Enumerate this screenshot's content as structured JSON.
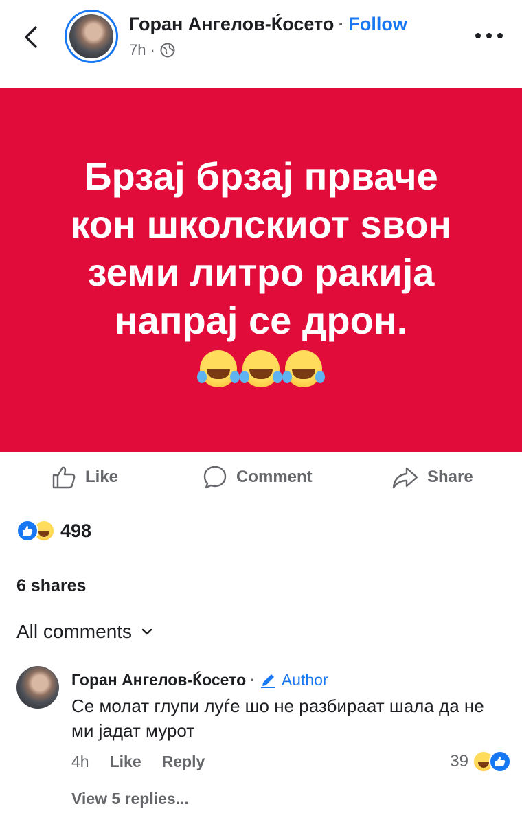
{
  "post": {
    "author": "Горан Ангелов-Ќосето",
    "separator": "·",
    "follow_label": "Follow",
    "time": "7h",
    "time_sep": "·",
    "privacy_icon": "globe-icon"
  },
  "banner": {
    "background": "#e10c3a",
    "lines": [
      "Брзај брзај прваче",
      "кон школскиот ѕвон",
      "земи литро ракија",
      "напрај се дрон."
    ],
    "emoji_icon": "laughing-tears-emoji"
  },
  "actions": {
    "like": "Like",
    "comment": "Comment",
    "share": "Share"
  },
  "stats": {
    "reactions_count": "498",
    "shares": "6 shares"
  },
  "comments": {
    "filter_label": "All comments",
    "items": [
      {
        "author": "Горан Ангелов-Ќосето",
        "separator": "·",
        "badge": "Author",
        "text": "Се молат глупи луѓе шо не разбираат шала да не ми јадат мурот",
        "time": "4h",
        "like": "Like",
        "reply": "Reply",
        "reaction_count": "39",
        "view_replies": "View 5 replies..."
      }
    ]
  },
  "colors": {
    "accent": "#1877f2",
    "muted": "#65676b"
  }
}
